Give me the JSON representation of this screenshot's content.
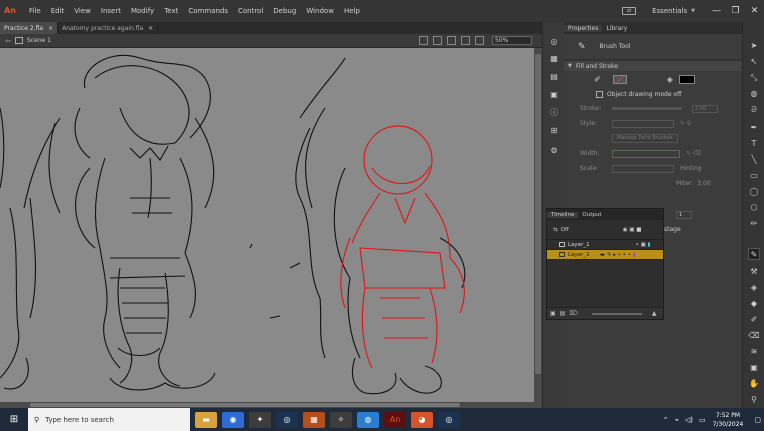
{
  "app": {
    "logo": "An"
  },
  "menu": [
    "File",
    "Edit",
    "View",
    "Insert",
    "Modify",
    "Text",
    "Commands",
    "Control",
    "Debug",
    "Window",
    "Help"
  ],
  "workspace": {
    "label": "Essentials",
    "minimize": "—",
    "maximize": "❐",
    "close": "✕"
  },
  "doc_tabs": [
    {
      "label": "Practice 2.fla",
      "close": "✕"
    },
    {
      "label": "Anatomy practice again.fla",
      "close": "✕"
    }
  ],
  "scene": {
    "back": "⇦",
    "label": "Scene 1",
    "zoom": "50%"
  },
  "props": {
    "tabs": [
      "Properties",
      "Library"
    ],
    "tool_name": "Brush Tool",
    "fill_stroke_title": "Fill and Stroke",
    "draw_mode": "Object drawing mode off",
    "stroke_label": "Stroke:",
    "stroke_value": "2.00",
    "style_label": "Style:",
    "manage_brushes": "Manage Paint Brushes",
    "width_label": "Width:",
    "scale_label": "Scale:",
    "hinting": "Hinting",
    "miter_label": "Miter:",
    "miter_value": "3.00",
    "field_value": "1",
    "stage_text": "stage"
  },
  "timeline": {
    "tabs": [
      "Timeline",
      "Output"
    ],
    "onion_label": "Off",
    "layers": [
      "Layer_1",
      "Layer_2"
    ]
  },
  "taskbar": {
    "search_placeholder": "Type here to search",
    "time": "7:52 PM",
    "date": "7/30/2024"
  }
}
